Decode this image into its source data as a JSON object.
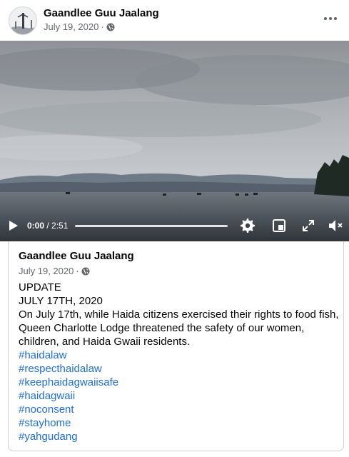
{
  "post": {
    "author": "Gaandlee Guu Jaalang",
    "date": "July 19, 2020",
    "separator": "·",
    "privacy_icon": "globe-icon",
    "more_icon": "more-options-icon"
  },
  "video": {
    "current_time": "0:00",
    "duration": "2:51",
    "time_separator": " / ",
    "progress": 0,
    "icons": [
      "play-icon",
      "settings-icon",
      "miniplayer-icon",
      "fullscreen-icon",
      "volume-muted-icon"
    ]
  },
  "shared": {
    "author": "Gaandlee Guu Jaalang",
    "date": "July 19, 2020",
    "separator": "·",
    "lines": [
      "UPDATE",
      "JULY 17TH, 2020",
      "On July 17th, while Haida citizens exercised their rights to food fish, Queen Charlotte Lodge threatened the safety of our women, children, and Haida Gwaii residents."
    ],
    "hashtags": [
      "#haidalaw",
      "#respecthaidalaw",
      "#keephaidagwaiisafe",
      "#haidagwaii",
      "#noconsent",
      "#stayhome",
      "#yahgudang"
    ]
  },
  "colors": {
    "link": "#216fdb",
    "meta": "#65676b",
    "border": "#ced0d4"
  }
}
